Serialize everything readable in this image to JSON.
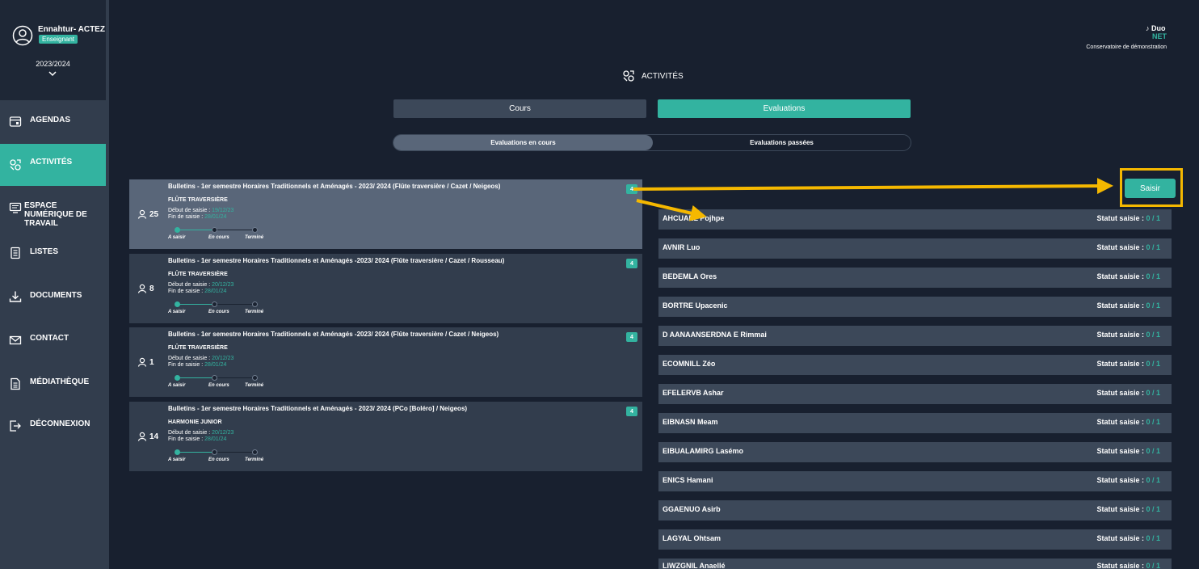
{
  "sidebar": {
    "user_name": "Ennahtur- ACTEZ",
    "user_role": "Enseignant",
    "school_year": "2023/2024",
    "items": [
      {
        "label": "AGENDAS",
        "icon": "calendar-icon"
      },
      {
        "label": "ACTIVITÉS",
        "icon": "activities-icon"
      },
      {
        "label": "ESPACE NUMÉRIQUE DE TRAVAIL",
        "icon": "workspace-icon"
      },
      {
        "label": "LISTES",
        "icon": "lists-icon"
      },
      {
        "label": "DOCUMENTS",
        "icon": "download-icon"
      },
      {
        "label": "CONTACT",
        "icon": "mail-icon"
      },
      {
        "label": "MÉDIATHÈQUE",
        "icon": "media-library-icon"
      },
      {
        "label": "DÉCONNEXION",
        "icon": "logout-icon"
      }
    ]
  },
  "header": {
    "logo_line1": "Duo",
    "logo_line2": "NET",
    "logo_subtitle": "Conservatoire de démonstration",
    "page_title": "ACTIVITÉS"
  },
  "tabs": {
    "cours": "Cours",
    "evaluations": "Evaluations"
  },
  "subtabs": {
    "current": "Evaluations en cours",
    "past": "Evaluations passées"
  },
  "step_labels": {
    "a_saisir": "A saisir",
    "en_cours": "En cours",
    "termine": "Terminé"
  },
  "labels": {
    "debut": "Début de saisie :",
    "fin": "Fin de saisie :",
    "statut": "Statut saisie :",
    "action_button": "Saisir"
  },
  "accent_color": "#33b3a0",
  "annotation_color": "#f5b800",
  "cards": [
    {
      "title": "Bulletins - 1er semestre Horaires Traditionnels et Aménagés - 2023/ 2024 (Flûte traversière / Cazet / Neigeos)",
      "instrument": "FLÛTE TRAVERSIÈRE",
      "start": "19/12/23",
      "end": "28/01/24",
      "count": "25",
      "badge": "4"
    },
    {
      "title": "Bulletins - 1er semestre Horaires Traditionnels et Aménagés -2023/ 2024 (Flûte traversière / Cazet / Rousseau)",
      "instrument": "FLÛTE TRAVERSIÈRE",
      "start": "20/12/23",
      "end": "28/01/24",
      "count": "8",
      "badge": "4"
    },
    {
      "title": "Bulletins - 1er semestre Horaires Traditionnels et Aménagés -2023/ 2024 (Flûte traversière / Cazet / Neigeos)",
      "instrument": "FLÛTE TRAVERSIÈRE",
      "start": "20/12/23",
      "end": "28/01/24",
      "count": "1",
      "badge": "4"
    },
    {
      "title": "Bulletins - 1er semestre Horaires Traditionnels et Aménagés - 2023/ 2024 (PCo [Boléro] / Neigeos)",
      "instrument": "HARMONIE JUNIOR",
      "start": "20/12/23",
      "end": "28/01/24",
      "count": "14",
      "badge": "4"
    }
  ],
  "students": [
    {
      "name": "AHCUAEL Pojhpe",
      "status": "0 / 1"
    },
    {
      "name": "AVNIR Luo",
      "status": "0 / 1"
    },
    {
      "name": "BEDEMLA Ores",
      "status": "0 / 1"
    },
    {
      "name": "BORTRE Upacenic",
      "status": "0 / 1"
    },
    {
      "name": "D AANAANSERDNA E Rimmai",
      "status": "0 / 1"
    },
    {
      "name": "ECOMNILL Zéo",
      "status": "0 / 1"
    },
    {
      "name": "EFELERVB Ashar",
      "status": "0 / 1"
    },
    {
      "name": "EIBNASN Meam",
      "status": "0 / 1"
    },
    {
      "name": "EIBUALAMIRG Lasémo",
      "status": "0 / 1"
    },
    {
      "name": "ENICS Hamani",
      "status": "0 / 1"
    },
    {
      "name": "GGAENUO Asirb",
      "status": "0 / 1"
    },
    {
      "name": "LAGYAL Ohtsam",
      "status": "0 / 1"
    },
    {
      "name": "LIWZGNIL Anaellé",
      "status": "0 / 1"
    }
  ]
}
